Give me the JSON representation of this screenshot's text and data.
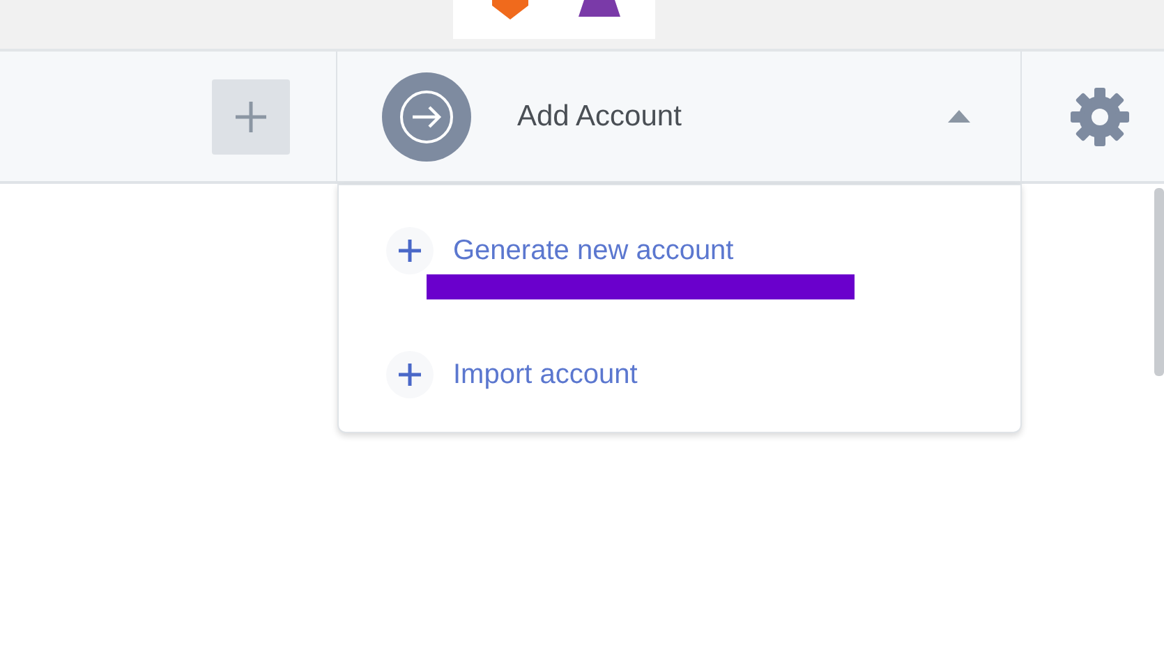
{
  "account_selector": {
    "label": "Add Account",
    "expanded": true
  },
  "menu_items": [
    {
      "label": "Generate new account",
      "highlighted": true
    },
    {
      "label": "Import account",
      "highlighted": false
    }
  ]
}
